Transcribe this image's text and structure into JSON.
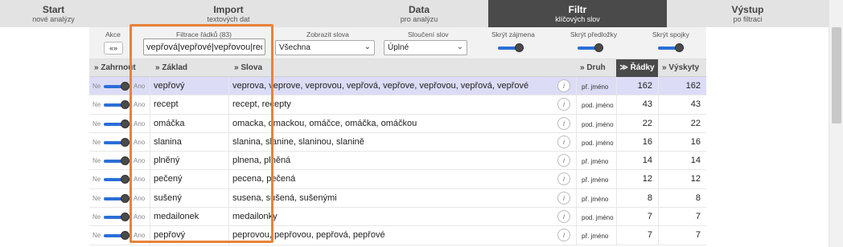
{
  "nav": [
    {
      "title": "Start",
      "subtitle": "nové analýzy"
    },
    {
      "title": "Import",
      "subtitle": "textových dat"
    },
    {
      "title": "Data",
      "subtitle": "pro analýzu"
    },
    {
      "title": "Filtr",
      "subtitle": "klíčových slov"
    },
    {
      "title": "Výstup",
      "subtitle": "po filtraci"
    }
  ],
  "filterbar": {
    "akce_label": "Akce",
    "akce_button": "«»",
    "filter_label": "Filtrace řádků (83)",
    "filter_value": "vepřová|vepřové|vepřovou|rec",
    "zobrazit_label": "Zobrazit slova",
    "zobrazit_value": "Všechna",
    "slouceni_label": "Sloučení slov",
    "slouceni_value": "Úplné",
    "skryt_zajmena": "Skrýt zájmena",
    "skryt_predlozky": "Skrýt předložky",
    "skryt_spojky": "Skrýt spojky"
  },
  "table": {
    "headers": {
      "zahrnout": "» Zahrnout",
      "zaklad": "» Základ",
      "slova": "» Slova",
      "druh": "» Druh",
      "radky": "≫ Řádky",
      "vyskyty": "» Výskyty"
    },
    "toggle_no": "Ne",
    "toggle_yes": "Ano",
    "rows": [
      {
        "zaklad": "vepřový",
        "slova": "veprova, veprove, veprovou, vepřová, vepřove, vepřovou, vepřová, vepřové",
        "druh": "př. jméno",
        "radky": "162",
        "vyskyty": "162",
        "highlight": true
      },
      {
        "zaklad": "recept",
        "slova": "recept, recepty",
        "druh": "pod. jméno",
        "radky": "43",
        "vyskyty": "43"
      },
      {
        "zaklad": "omáčka",
        "slova": "omacka, omackou, omáčce, omáčka, omáčkou",
        "druh": "pod. jméno",
        "radky": "22",
        "vyskyty": "22"
      },
      {
        "zaklad": "slanina",
        "slova": "slanina, slanine, slaninou, slanině",
        "druh": "pod. jméno",
        "radky": "16",
        "vyskyty": "16"
      },
      {
        "zaklad": "plněný",
        "slova": "plnena, plněná",
        "druh": "př. jméno",
        "radky": "14",
        "vyskyty": "14"
      },
      {
        "zaklad": "pečený",
        "slova": "pecena, pečená",
        "druh": "př. jméno",
        "radky": "12",
        "vyskyty": "12"
      },
      {
        "zaklad": "sušený",
        "slova": "susena, sušená, sušenými",
        "druh": "př. jméno",
        "radky": "8",
        "vyskyty": "8"
      },
      {
        "zaklad": "medailonek",
        "slova": "medailonky",
        "druh": "pod. jméno",
        "radky": "7",
        "vyskyty": "7"
      },
      {
        "zaklad": "pepřový",
        "slova": "peprovou, pepřovou, pepřová, pepřové",
        "druh": "př. jméno",
        "radky": "7",
        "vyskyty": "7"
      }
    ]
  },
  "colors": {
    "accent": "#2a6fd6",
    "highlight_row": "#dcdcf7",
    "annotation": "#e8823a",
    "active_tab": "#4a4a4a"
  }
}
